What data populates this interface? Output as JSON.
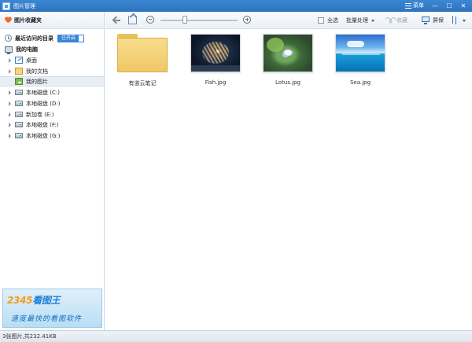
{
  "window": {
    "title": "图片管理",
    "menu_label": "菜单",
    "minimize": "—",
    "maximize": "☐",
    "close": "✕"
  },
  "sidebar": {
    "favorites_label": "图片收藏夹",
    "recent_label": "最近访问的目录",
    "recent_toggle": "已开启",
    "computer_label": "我的电脑",
    "items": [
      {
        "label": "桌面",
        "icon": "desktop-icon",
        "expandable": true
      },
      {
        "label": "我的文档",
        "icon": "documents-icon",
        "expandable": true
      },
      {
        "label": "我的图片",
        "icon": "pictures-icon",
        "expandable": false,
        "selected": true
      },
      {
        "label": "本地磁盘 (C:)",
        "icon": "drive-icon",
        "expandable": true
      },
      {
        "label": "本地磁盘 (D:)",
        "icon": "drive-icon",
        "expandable": true
      },
      {
        "label": "新加卷 (E:)",
        "icon": "drive-icon",
        "expandable": true
      },
      {
        "label": "本地磁盘 (F:)",
        "icon": "drive-icon",
        "expandable": true
      },
      {
        "label": "本地磁盘 (G:)",
        "icon": "drive-icon",
        "expandable": true
      }
    ],
    "ad": {
      "brand_num": "2345",
      "brand_text": "看图王",
      "slogan": "速度最快的看图软件"
    }
  },
  "toolbar": {
    "select_all": "全选",
    "batch": "批量处理",
    "favorite": "收藏",
    "screen": "屏保",
    "zoom_level": 0.5
  },
  "content": {
    "items": [
      {
        "caption": "有道云笔记",
        "type": "folder"
      },
      {
        "caption": "Fish.jpg",
        "type": "image"
      },
      {
        "caption": "Lotus.jpg",
        "type": "image"
      },
      {
        "caption": "Sea.jpg",
        "type": "image"
      }
    ]
  },
  "status": {
    "text": "3张图片,共232.41KB"
  },
  "colors": {
    "titlebar": "#2e74be",
    "accent": "#3a86d4",
    "favorite_heart": "#f06a2e"
  }
}
